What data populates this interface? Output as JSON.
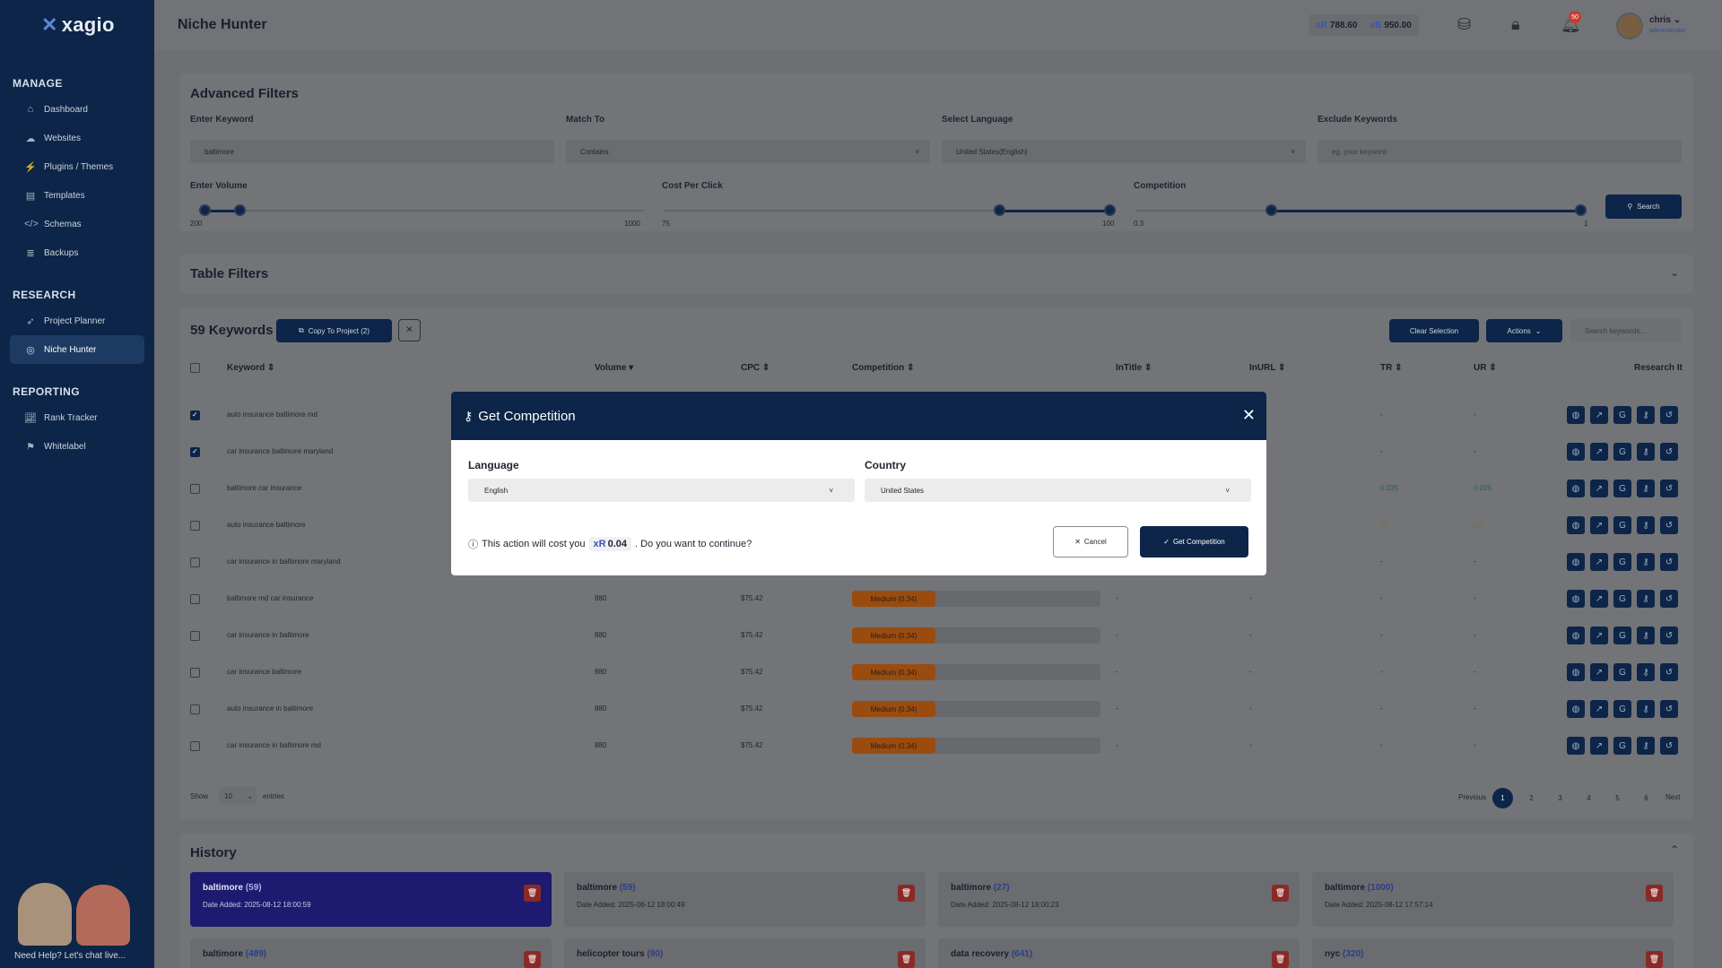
{
  "app": {
    "brand": "xagio",
    "page_title": "Niche Hunter"
  },
  "header": {
    "credits": [
      {
        "symbol": "xR",
        "value": "788.60"
      },
      {
        "symbol": "xB",
        "value": "950.00"
      }
    ],
    "notifications_count": "50",
    "user": {
      "name": "chris",
      "role": "administrator"
    }
  },
  "sidebar": {
    "sections": [
      {
        "title": "MANAGE",
        "items": [
          {
            "label": "Dashboard",
            "icon": "home-icon"
          },
          {
            "label": "Websites",
            "icon": "cloud-icon"
          },
          {
            "label": "Plugins / Themes",
            "icon": "plug-icon"
          },
          {
            "label": "Templates",
            "icon": "template-icon"
          },
          {
            "label": "Schemas",
            "icon": "code-icon"
          },
          {
            "label": "Backups",
            "icon": "database-icon"
          }
        ]
      },
      {
        "title": "RESEARCH",
        "items": [
          {
            "label": "Project Planner",
            "icon": "rocket-icon"
          },
          {
            "label": "Niche Hunter",
            "icon": "target-icon",
            "active": true
          }
        ]
      },
      {
        "title": "REPORTING",
        "items": [
          {
            "label": "Rank Tracker",
            "icon": "chart-icon"
          },
          {
            "label": "Whitelabel",
            "icon": "bookmark-icon"
          }
        ]
      }
    ]
  },
  "filters": {
    "title": "Advanced Filters",
    "keyword_label": "Enter Keyword",
    "keyword_value": "baltimore",
    "match_label": "Match To",
    "match_value": "Contains",
    "language_label": "Select Language",
    "language_value": "United States(English)",
    "exclude_label": "Exclude Keywords",
    "exclude_placeholder": "eg. your keyword",
    "volume_label": "Enter Volume",
    "volume_min": "200",
    "volume_max": "1000",
    "cpc_label": "Cost Per Click",
    "cpc_min": "75",
    "cpc_max": "100",
    "competition_label": "Competition",
    "competition_min": "0.3",
    "competition_max": "1",
    "search_label": "Search"
  },
  "table_filters": {
    "title": "Table Filters"
  },
  "keywords": {
    "count_label": "59 Keywords",
    "copy_label": "Copy To Project (2)",
    "clear_label": "Clear Selection",
    "actions_label": "Actions",
    "search_placeholder": "Search keywords...",
    "columns": [
      "Keyword",
      "Volume",
      "CPC",
      "Competition",
      "InTitle",
      "InURL",
      "TR",
      "UR",
      "Research It"
    ],
    "rows": [
      {
        "keyword": "auto insurance baltimore md",
        "checked": true,
        "volume": "",
        "cpc": "",
        "comp": "",
        "intitle": "",
        "inurl": "",
        "tr": "-",
        "ur": "-"
      },
      {
        "keyword": "car insurance baltimore maryland",
        "checked": true,
        "volume": "",
        "cpc": "",
        "comp": "",
        "intitle": "",
        "inurl": "",
        "tr": "-",
        "ur": "-"
      },
      {
        "keyword": "baltimore car insurance",
        "checked": false,
        "volume": "",
        "cpc": "",
        "comp": "",
        "intitle": "",
        "inurl": "",
        "tr": "0.035",
        "ur": "0.025"
      },
      {
        "keyword": "auto insurance baltimore",
        "checked": false,
        "volume": "",
        "cpc": "",
        "comp": "",
        "intitle": "",
        "inurl": "",
        "tr": "",
        "ur": ""
      },
      {
        "keyword": "car insurance in baltimore maryland",
        "checked": false,
        "volume": "",
        "cpc": "",
        "comp": "",
        "intitle": "",
        "inurl": "",
        "tr": "-",
        "ur": "-"
      },
      {
        "keyword": "baltimore md car insurance",
        "checked": false,
        "volume": "880",
        "cpc": "$75.42",
        "comp": "Medium (0.34)",
        "intitle": "-",
        "inurl": "-",
        "tr": "-",
        "ur": "-"
      },
      {
        "keyword": "car insurance in baltimore",
        "checked": false,
        "volume": "880",
        "cpc": "$75.42",
        "comp": "Medium (0.34)",
        "intitle": "-",
        "inurl": "-",
        "tr": "-",
        "ur": "-"
      },
      {
        "keyword": "car insurance baltimore",
        "checked": false,
        "volume": "880",
        "cpc": "$75.42",
        "comp": "Medium (0.34)",
        "intitle": "-",
        "inurl": "-",
        "tr": "-",
        "ur": "-"
      },
      {
        "keyword": "auto insurance in baltimore",
        "checked": false,
        "volume": "880",
        "cpc": "$75.42",
        "comp": "Medium (0.34)",
        "intitle": "-",
        "inurl": "-",
        "tr": "-",
        "ur": "-"
      },
      {
        "keyword": "car insurance in baltimore md",
        "checked": false,
        "volume": "880",
        "cpc": "$75.42",
        "comp": "Medium (0.34)",
        "intitle": "-",
        "inurl": "-",
        "tr": "-",
        "ur": "-"
      }
    ],
    "show_label": "Show",
    "page_size": "10",
    "entries_label": "entries",
    "pagination": {
      "previous": "Previous",
      "pages": [
        "1",
        "2",
        "3",
        "4",
        "5",
        "6"
      ],
      "current": "1",
      "next": "Next"
    }
  },
  "history": {
    "title": "History",
    "items": [
      {
        "name": "baltimore",
        "count": "(59)",
        "date": "Date Added: 2025-08-12 18:00:59",
        "selected": true
      },
      {
        "name": "baltimore",
        "count": "(59)",
        "date": "Date Added: 2025-08-12 18:00:49"
      },
      {
        "name": "baltimore",
        "count": "(27)",
        "date": "Date Added: 2025-08-12 18:00:23"
      },
      {
        "name": "baltimore",
        "count": "(1000)",
        "date": "Date Added: 2025-08-12 17:57:14"
      },
      {
        "name": "baltimore",
        "count": "(489)",
        "date": ""
      },
      {
        "name": "helicopter tours",
        "count": "(90)",
        "date": ""
      },
      {
        "name": "data recovery",
        "count": "(641)",
        "date": ""
      },
      {
        "name": "nyc",
        "count": "(320)",
        "date": ""
      }
    ]
  },
  "modal": {
    "title": "Get Competition",
    "language_label": "Language",
    "language_value": "English",
    "country_label": "Country",
    "country_value": "United States",
    "cost_prefix": "This action will cost you",
    "cost_symbol": "xR",
    "cost_value": "0.04",
    "cost_suffix": ". Do you want to continue?",
    "cancel_label": "Cancel",
    "confirm_label": "Get Competition"
  },
  "chat": {
    "label": "Need Help? Let's chat live..."
  },
  "colors": {
    "navy": "#0c2548",
    "medium_badge": "#9a4c0f",
    "history_selected": "#1e1a6f",
    "tr_positive": "#1e6b3a"
  }
}
